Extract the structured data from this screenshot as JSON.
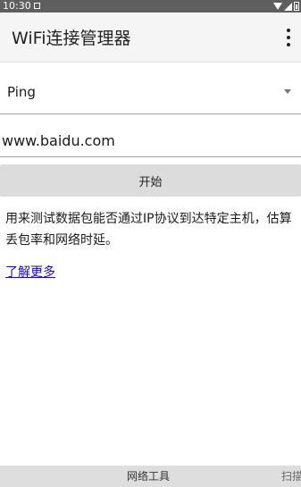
{
  "status_bar": {
    "time": "10:30"
  },
  "app_bar": {
    "title": "WiFi连接管理器",
    "overflow_icon": "more-vert-icon"
  },
  "tool_spinner": {
    "selected": "Ping"
  },
  "host_input": {
    "value": "www.baidu.com"
  },
  "start_button": {
    "label": "开始"
  },
  "description": "用来测试数据包能否通过IP协议到达特定主机，估算丢包率和网络时延。",
  "learn_more": "了解更多",
  "bottom_tabs": [
    {
      "label": "网络工具"
    },
    {
      "label": "扫描"
    }
  ]
}
